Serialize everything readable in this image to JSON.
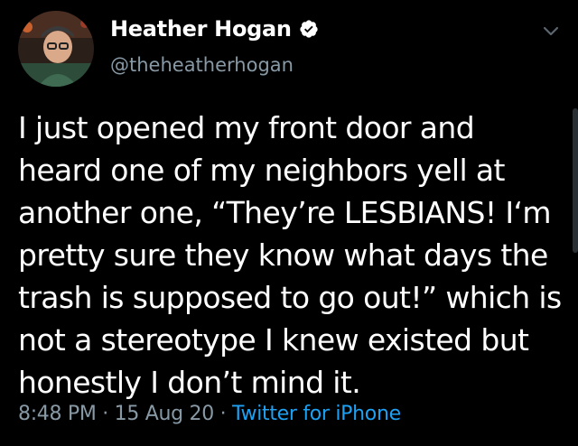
{
  "tweet": {
    "author": {
      "display_name": "Heather Hogan",
      "handle": "@theheatherhogan",
      "verified": true,
      "avatar_icon": "avatar-photo"
    },
    "text": "I just opened my front door and heard one of my neighbors yell at another one, “They’re LESBIANS! I‘m pretty sure they know what days the trash is supposed to go out!” which is not a stereotype I knew existed but honestly I don’t mind it.",
    "time": "8:48 PM",
    "separator": "·",
    "date": "15 Aug 20",
    "source": "Twitter for iPhone"
  },
  "icons": {
    "verified": "verified-badge-icon",
    "more": "chevron-down-icon"
  },
  "colors": {
    "background": "#000000",
    "text": "#ffffff",
    "secondary": "#8899a6",
    "link": "#1da1f2"
  }
}
